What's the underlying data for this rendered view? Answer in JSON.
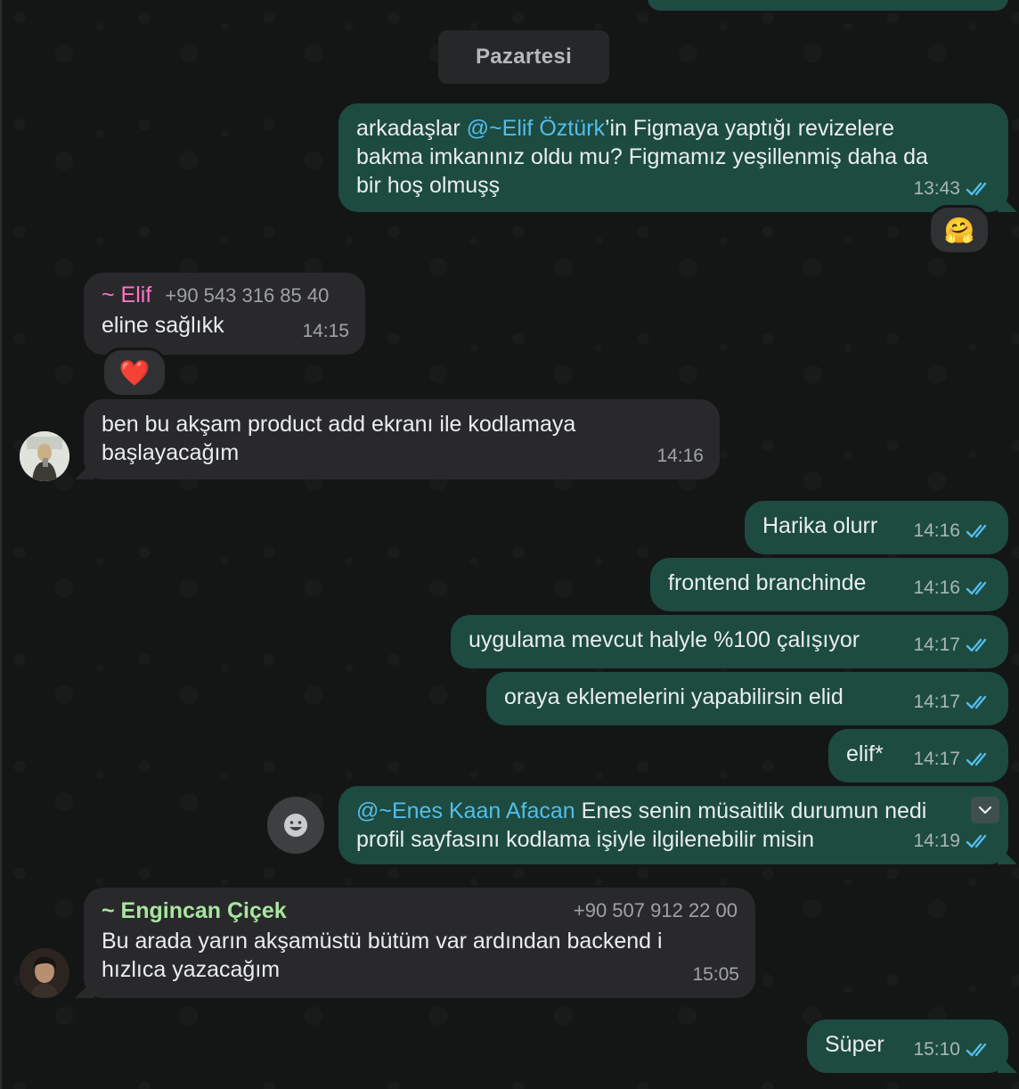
{
  "day_separator": "Pazartesi",
  "messages": {
    "m1": {
      "prefix": "arkadaşlar ",
      "mention": "@~Elif Öztürk",
      "suffix": "’in  Figmaya yaptığı revizelere bakma imkanınız oldu mu? Figmamız yeşillenmiş daha da bir hoş olmuşş",
      "time": "13:43",
      "reaction": "🤗"
    },
    "m2": {
      "sender": "~ Elif",
      "phone": "+90 543 316 85 40",
      "text": "eline sağlıkk",
      "time": "14:15",
      "reaction": "❤️"
    },
    "m3": {
      "text": "ben bu akşam product add ekranı ile kodlamaya başlayacağım",
      "time": "14:16"
    },
    "m4": {
      "text": "Harika olurr",
      "time": "14:16"
    },
    "m5": {
      "text": "frontend branchinde",
      "time": "14:16"
    },
    "m6": {
      "text": "uygulama mevcut halyle %100 çalışıyor",
      "time": "14:17"
    },
    "m7": {
      "text": "oraya eklemelerini yapabilirsin elid",
      "time": "14:17"
    },
    "m8": {
      "text": "elif*",
      "time": "14:17"
    },
    "m9": {
      "mention": "@~Enes Kaan Afacan",
      "line1_rest": " Enes senin müsaitlik durumun nedi",
      "line2": "profil sayfasını kodlama işiyle ilgilenebilir misin",
      "time": "14:19"
    },
    "m10": {
      "sender": "~ Engincan Çiçek",
      "phone": "+90 507 912 22 00",
      "text": "Bu arada yarın akşamüstü bütüm var ardından backend i hızlıca yazacağım",
      "time": "15:05"
    },
    "m11": {
      "text": "Süper",
      "time": "15:10"
    }
  },
  "colors": {
    "outgoing_bubble": "#1d4b40",
    "incoming_bubble": "#29292b",
    "read_ticks": "#53bdeb",
    "mention": "#53bdeb"
  },
  "icons": {
    "read_receipt": "double-check-icon",
    "emoji": "emoji-smiley-icon",
    "menu": "chevron-down-icon"
  }
}
